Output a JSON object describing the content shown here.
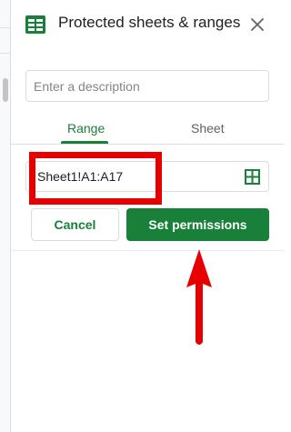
{
  "panel": {
    "title": "Protected sheets & ranges",
    "description_placeholder": "Enter a description",
    "description_value": "",
    "tabs": [
      {
        "label": "Range",
        "active": true
      },
      {
        "label": "Sheet",
        "active": false
      }
    ],
    "range_value": "Sheet1!A1:A17",
    "buttons": {
      "cancel": "Cancel",
      "set_permissions": "Set permissions"
    }
  },
  "icons": {
    "logo": "sheets-logo-icon",
    "close": "close-icon",
    "range_picker": "grid-select-icon",
    "annotation_arrow": "red-arrow"
  },
  "colors": {
    "accent_green": "#188038",
    "annotation_red": "#e60000",
    "border": "#dadce0",
    "muted_text": "#5f6368"
  }
}
